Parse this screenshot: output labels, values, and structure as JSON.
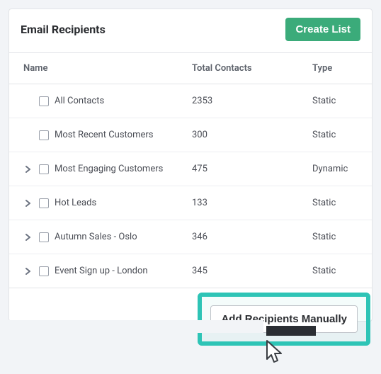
{
  "header": {
    "title": "Email Recipients",
    "create_label": "Create List"
  },
  "columns": {
    "name": "Name",
    "contacts": "Total Contacts",
    "type": "Type"
  },
  "rows": [
    {
      "name": "All Contacts",
      "contacts": "2353",
      "type": "Static",
      "expandable": false
    },
    {
      "name": "Most Recent Customers",
      "contacts": "300",
      "type": "Static",
      "expandable": false
    },
    {
      "name": "Most Engaging Customers",
      "contacts": "475",
      "type": "Dynamic",
      "expandable": true
    },
    {
      "name": "Hot Leads",
      "contacts": "133",
      "type": "Static",
      "expandable": true
    },
    {
      "name": "Autumn Sales - Oslo",
      "contacts": "346",
      "type": "Static",
      "expandable": true
    },
    {
      "name": "Event Sign up - London",
      "contacts": "345",
      "type": "Static",
      "expandable": true
    }
  ],
  "footer": {
    "add_manual_label": "Add Recipients Manually"
  }
}
